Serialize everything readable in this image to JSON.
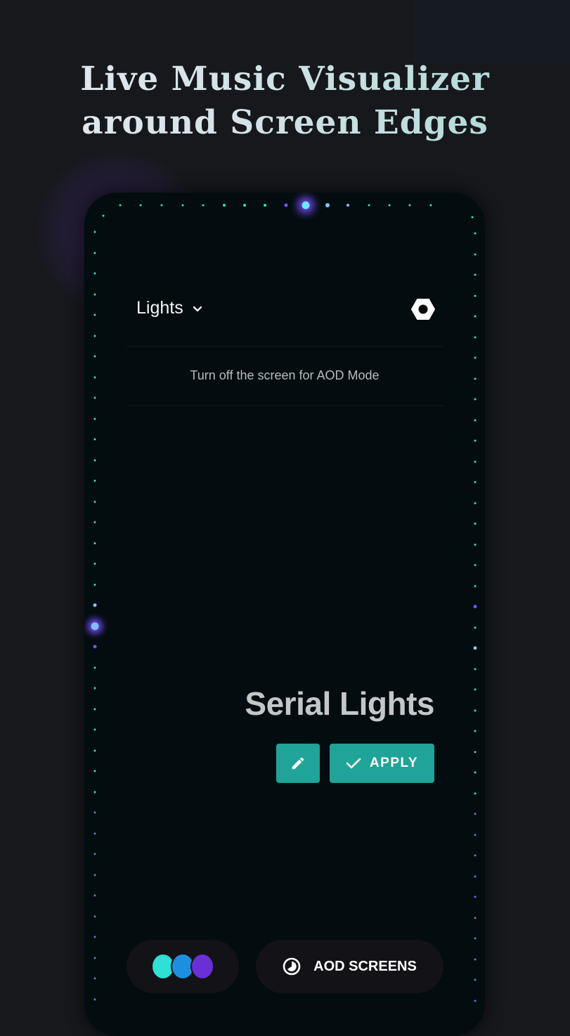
{
  "headline": {
    "line1": "Live Music Visualizer",
    "line2": "around Screen Edges"
  },
  "app": {
    "dropdown_label": "Lights",
    "dropdown_icon": "chevron-down-icon",
    "settings_icon": "hexagon-settings-icon",
    "aod_hint": "Turn off the screen for AOD Mode",
    "theme_name": "Serial Lights",
    "edit_icon": "pencil-icon",
    "apply_label": "APPLY",
    "apply_icon": "check-icon",
    "color_swatches": [
      "#2ee0d6",
      "#1e8fe0",
      "#6a2fd6"
    ],
    "aod_screens_label": "AOD SCREENS",
    "aod_screens_icon": "clock-icon"
  },
  "colors": {
    "accent": "#20a398",
    "led_teal": "#2ee0c8",
    "led_purple": "#7a4dff",
    "led_blue": "#7fc8ff"
  }
}
